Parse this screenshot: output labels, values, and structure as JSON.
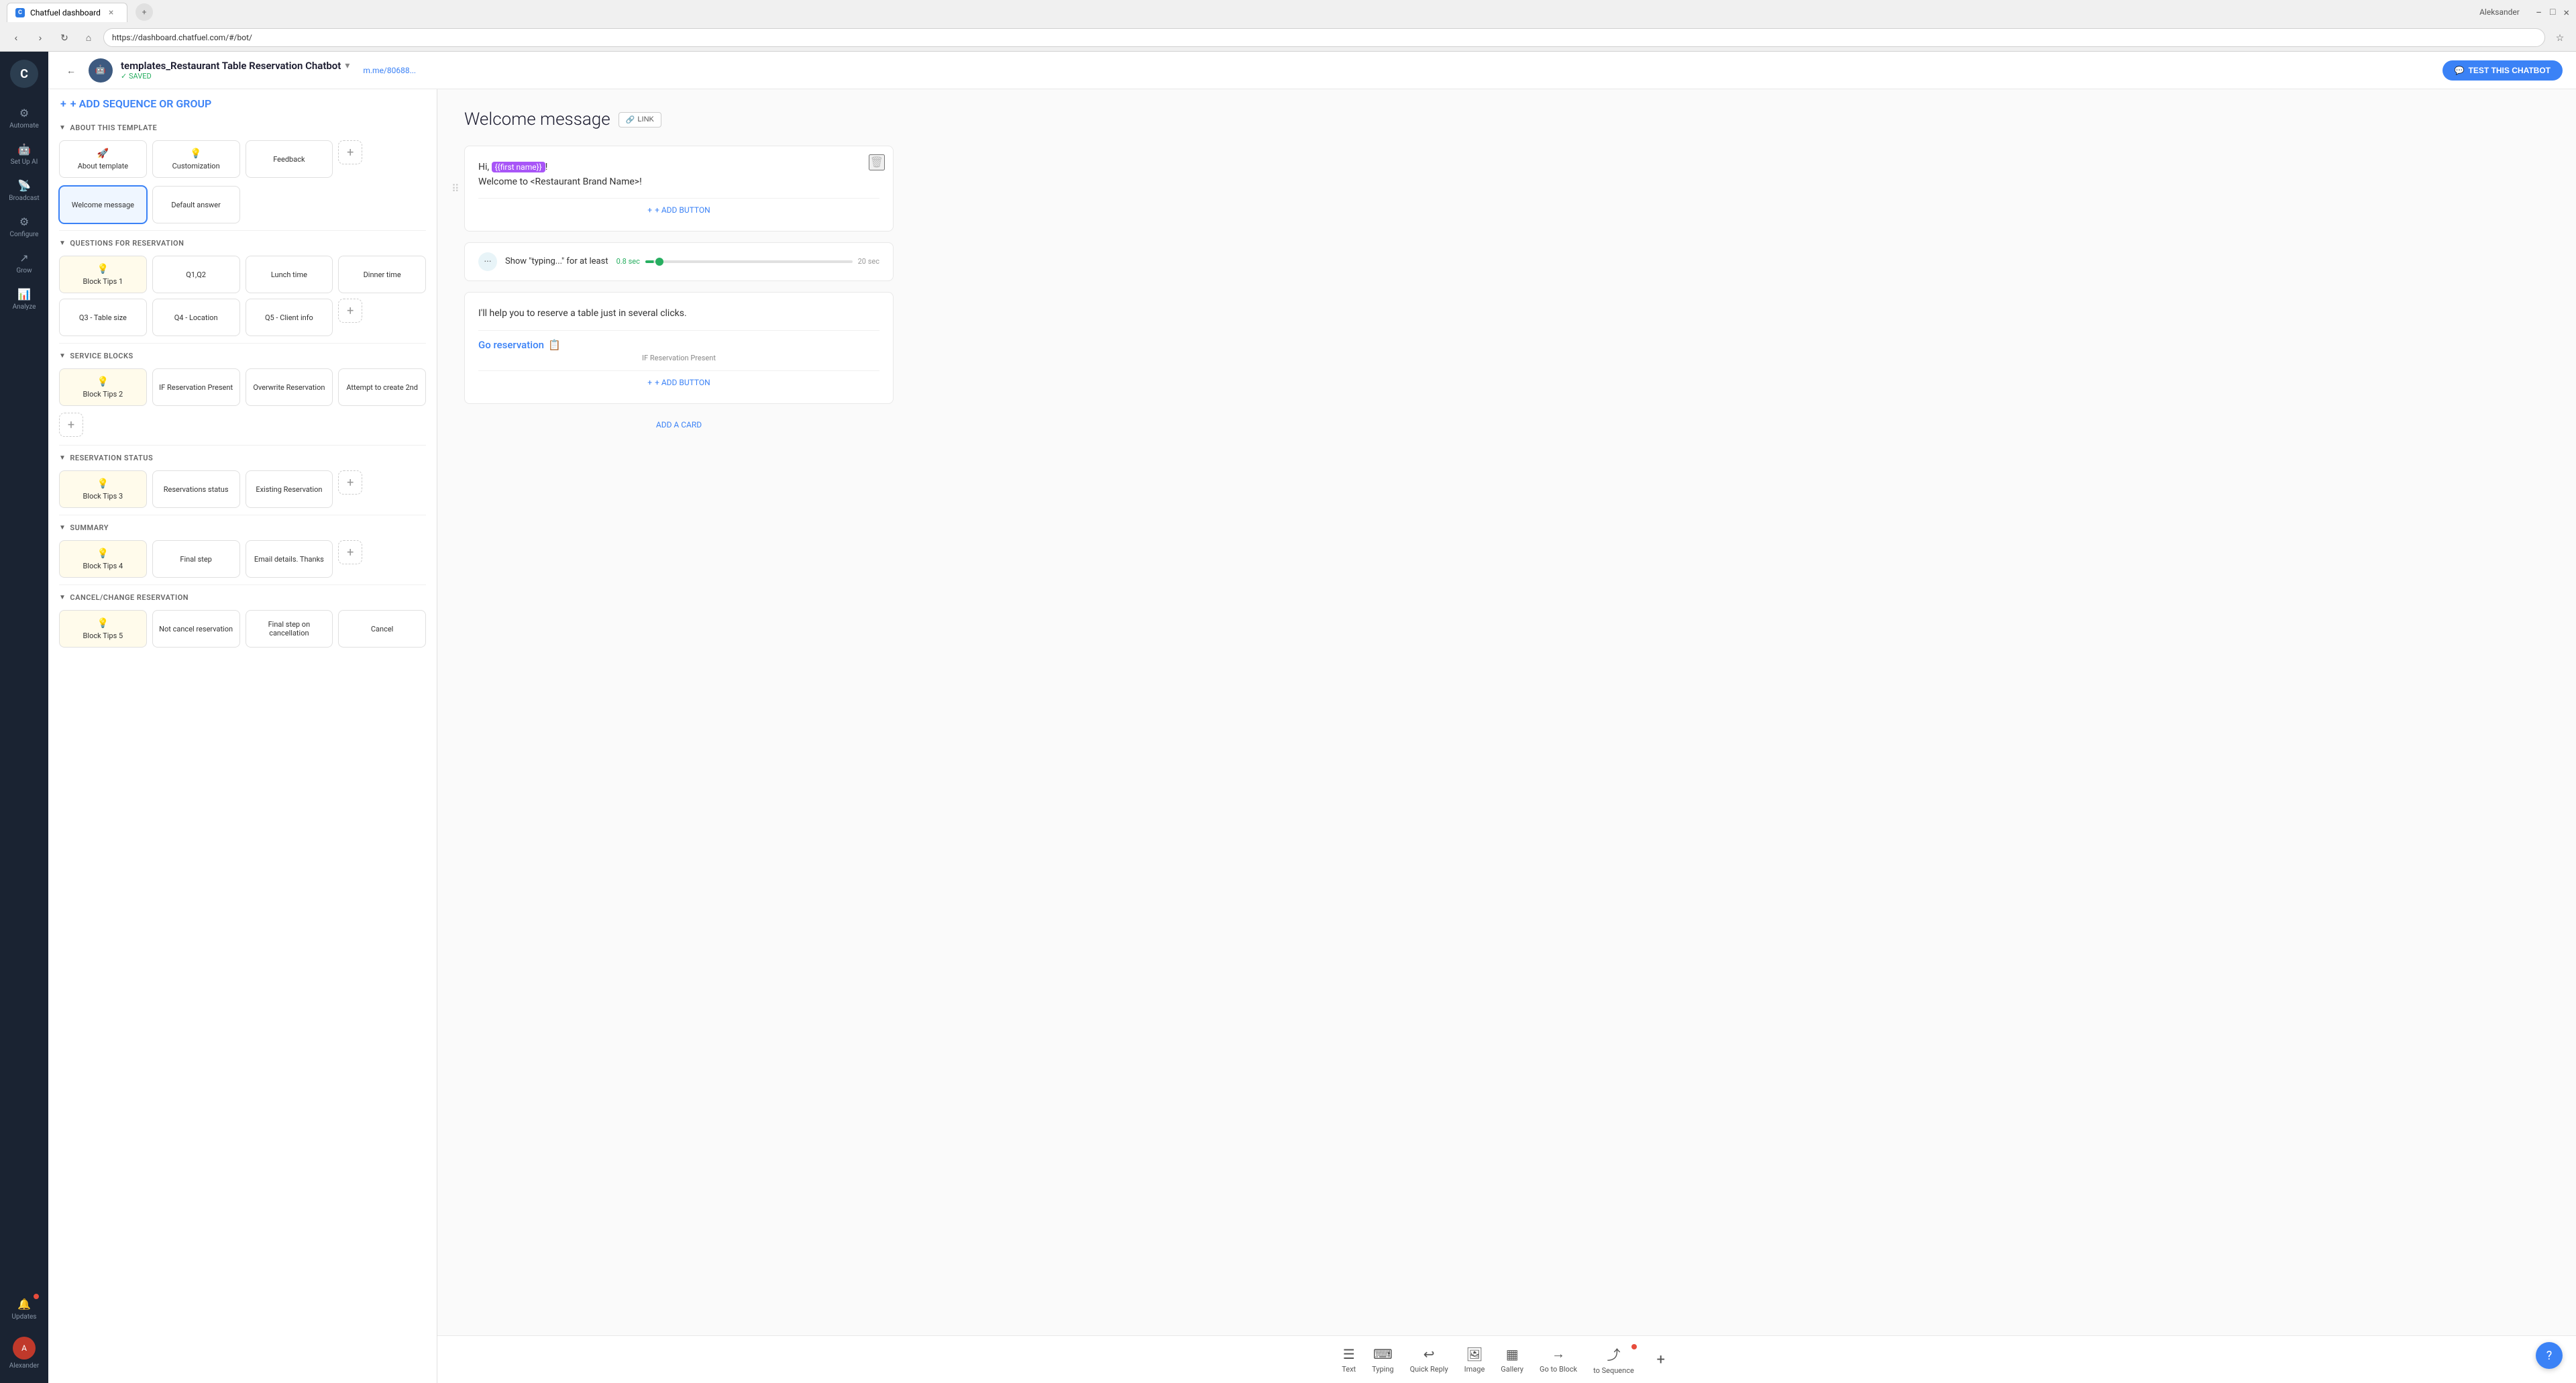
{
  "browser": {
    "tab_title": "Chatfuel dashboard",
    "tab_close": "×",
    "url": "https://dashboard.chatfuel.com/#/bot/",
    "user_name": "Aleksander"
  },
  "header": {
    "bot_name": "templates_Restaurant Table Reservation Chatbot",
    "saved_label": "SAVED",
    "link_text": "m.me/80688...",
    "chevron": "▾",
    "back": "←",
    "test_btn": "TEST THIS CHATBOT"
  },
  "sidebar": {
    "logo": "C",
    "items": [
      {
        "icon": "⚙",
        "label": "Automate"
      },
      {
        "icon": "🤖",
        "label": "Set Up AI"
      },
      {
        "icon": "📡",
        "label": "Broadcast"
      },
      {
        "icon": "⚙",
        "label": "Configure"
      },
      {
        "icon": "↗",
        "label": "Grow"
      },
      {
        "icon": "📊",
        "label": "Analyze"
      }
    ],
    "updates_label": "Updates",
    "user_label": "Alexander"
  },
  "blocks_panel": {
    "add_sequence_label": "+ ADD SEQUENCE OR GROUP",
    "groups": [
      {
        "id": "about",
        "label": "ABOUT THIS TEMPLATE",
        "blocks": [
          {
            "icon": "🚀",
            "label": "About template",
            "type": "normal"
          },
          {
            "icon": "💡",
            "label": "Customization",
            "type": "normal"
          },
          {
            "icon": "",
            "label": "Feedback",
            "type": "normal"
          },
          {
            "label": "+",
            "type": "add"
          }
        ]
      },
      {
        "id": "sequence1",
        "blocks": [
          {
            "icon": "💬",
            "label": "Welcome message",
            "type": "active"
          },
          {
            "icon": "",
            "label": "Default answer",
            "type": "normal"
          }
        ]
      },
      {
        "id": "questions",
        "label": "QUESTIONS FOR RESERVATION",
        "blocks": [
          {
            "icon": "💡",
            "label": "Block Tips 1",
            "type": "tip"
          },
          {
            "icon": "",
            "label": "Q1,Q2",
            "type": "normal"
          },
          {
            "icon": "",
            "label": "Lunch time",
            "type": "normal"
          },
          {
            "icon": "",
            "label": "Dinner time",
            "type": "normal"
          },
          {
            "icon": "",
            "label": "Q3 - Table size",
            "type": "normal"
          },
          {
            "icon": "",
            "label": "Q4 - Location",
            "type": "normal"
          },
          {
            "icon": "",
            "label": "Q5 - Client info",
            "type": "normal"
          },
          {
            "label": "+",
            "type": "add"
          }
        ]
      },
      {
        "id": "service",
        "label": "SERVICE BLOCKS",
        "blocks": [
          {
            "icon": "💡",
            "label": "Block Tips 2",
            "type": "tip"
          },
          {
            "icon": "",
            "label": "IF Reservation Present",
            "type": "normal"
          },
          {
            "icon": "",
            "label": "Overwrite Reservation",
            "type": "normal"
          },
          {
            "icon": "",
            "label": "Attempt to create 2nd",
            "type": "normal"
          },
          {
            "label": "+",
            "type": "add-wide"
          }
        ]
      },
      {
        "id": "reservation_status",
        "label": "RESERVATION STATUS",
        "blocks": [
          {
            "icon": "💡",
            "label": "Block Tips 3",
            "type": "tip"
          },
          {
            "icon": "",
            "label": "Reservations status",
            "type": "normal"
          },
          {
            "icon": "",
            "label": "Existing Reservation",
            "type": "normal"
          },
          {
            "label": "+",
            "type": "add"
          }
        ]
      },
      {
        "id": "summary",
        "label": "SUMMARY",
        "blocks": [
          {
            "icon": "💡",
            "label": "Block Tips 4",
            "type": "tip"
          },
          {
            "icon": "",
            "label": "Final step",
            "type": "normal"
          },
          {
            "icon": "",
            "label": "Email details. Thanks",
            "type": "normal"
          },
          {
            "label": "+",
            "type": "add"
          }
        ]
      },
      {
        "id": "cancel",
        "label": "CANCEL/CHANGE RESERVATION",
        "blocks": [
          {
            "icon": "💡",
            "label": "Block Tips 5",
            "type": "tip"
          },
          {
            "icon": "",
            "label": "Not cancel reservation",
            "type": "normal"
          },
          {
            "icon": "",
            "label": "Final step on cancellation",
            "type": "normal"
          },
          {
            "icon": "",
            "label": "Cancel",
            "type": "normal"
          }
        ]
      }
    ]
  },
  "content": {
    "block_title": "Welcome message",
    "link_btn": "LINK",
    "message1": {
      "greeting": "Hi, ",
      "var": "{{first name}}",
      "exclaim": "!",
      "body": "Welcome to <Restaurant Brand Name>!",
      "add_button_label": "+ ADD BUTTON"
    },
    "typing": {
      "label": "Show \"typing...\" for at least",
      "value": "0.8 sec",
      "max": "20 sec"
    },
    "message2": {
      "text": "I'll help you to reserve a table just in several clicks.",
      "button_text": "Go reservation",
      "button_sub": "IF Reservation Present",
      "add_button_label": "+ ADD BUTTON"
    },
    "add_card_label": "ADD A CARD",
    "toolbar": {
      "items": [
        {
          "icon": "☰",
          "label": "Text"
        },
        {
          "icon": "⌨",
          "label": "Typing"
        },
        {
          "icon": "↩",
          "label": "Quick Reply"
        },
        {
          "icon": "🖼",
          "label": "Image"
        },
        {
          "icon": "▦",
          "label": "Gallery"
        },
        {
          "icon": "→",
          "label": "Go to Block"
        },
        {
          "icon": "⤴",
          "label": "to Sequence"
        }
      ],
      "add_icon": "+"
    }
  }
}
